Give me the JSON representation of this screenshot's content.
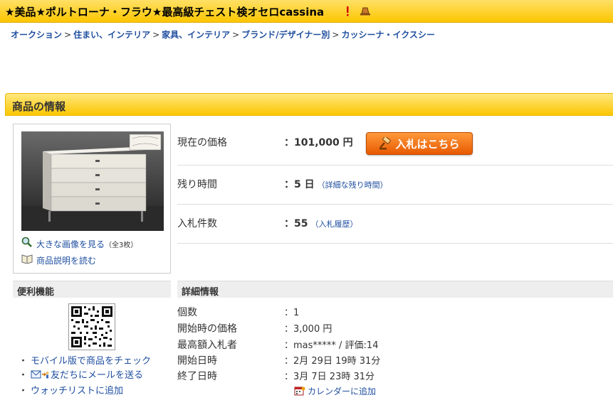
{
  "title": "★美品★ポルトローナ・フラウ★最高級チェスト検オセロcassina",
  "breadcrumb": [
    "オークション",
    "住まい、インテリア",
    "家具、インテリア",
    "ブランド/デザイナー別",
    "カッシーナ・イクスシー"
  ],
  "section_title": "商品の情報",
  "image_links": {
    "large_image": "大きな画像を見る",
    "large_image_count": "（全3枚）",
    "description": "商品説明を読む"
  },
  "info": {
    "price_label": "現在の価格",
    "price_value": "：101,000 円",
    "bid_button": "入札はこちら",
    "time_label": "残り時間",
    "time_value": "：5 日",
    "time_link": "（詳細な残り時間）",
    "bids_label": "入札件数",
    "bids_value": "：55",
    "bids_link": "（入札履歴）"
  },
  "convenience": {
    "header": "便利機能",
    "links": [
      "モバイル版で商品をチェック",
      "友だちにメールを送る",
      "ウォッチリストに追加"
    ]
  },
  "details": {
    "header": "詳細情報",
    "rows": [
      {
        "label": "個数",
        "value": "：1"
      },
      {
        "label": "開始時の価格",
        "value": "：3,000 円"
      },
      {
        "label": "最高額入札者",
        "value": "：mas***** / 評価:14"
      },
      {
        "label": "開始日時",
        "value": "：2月 29日 19時 31分"
      },
      {
        "label": "終了日時",
        "value": "：3月 7日 23時 31分"
      }
    ],
    "calendar_link": "カレンダーに追加"
  },
  "colors": {
    "header_yellow": "#fcc600",
    "link_blue": "#1f4fa0",
    "bid_orange": "#e85a00"
  },
  "icons": [
    "exclamation-icon",
    "hat-icon",
    "magnifier-icon",
    "book-icon",
    "gavel-icon",
    "mail-icon",
    "calendar-icon"
  ]
}
